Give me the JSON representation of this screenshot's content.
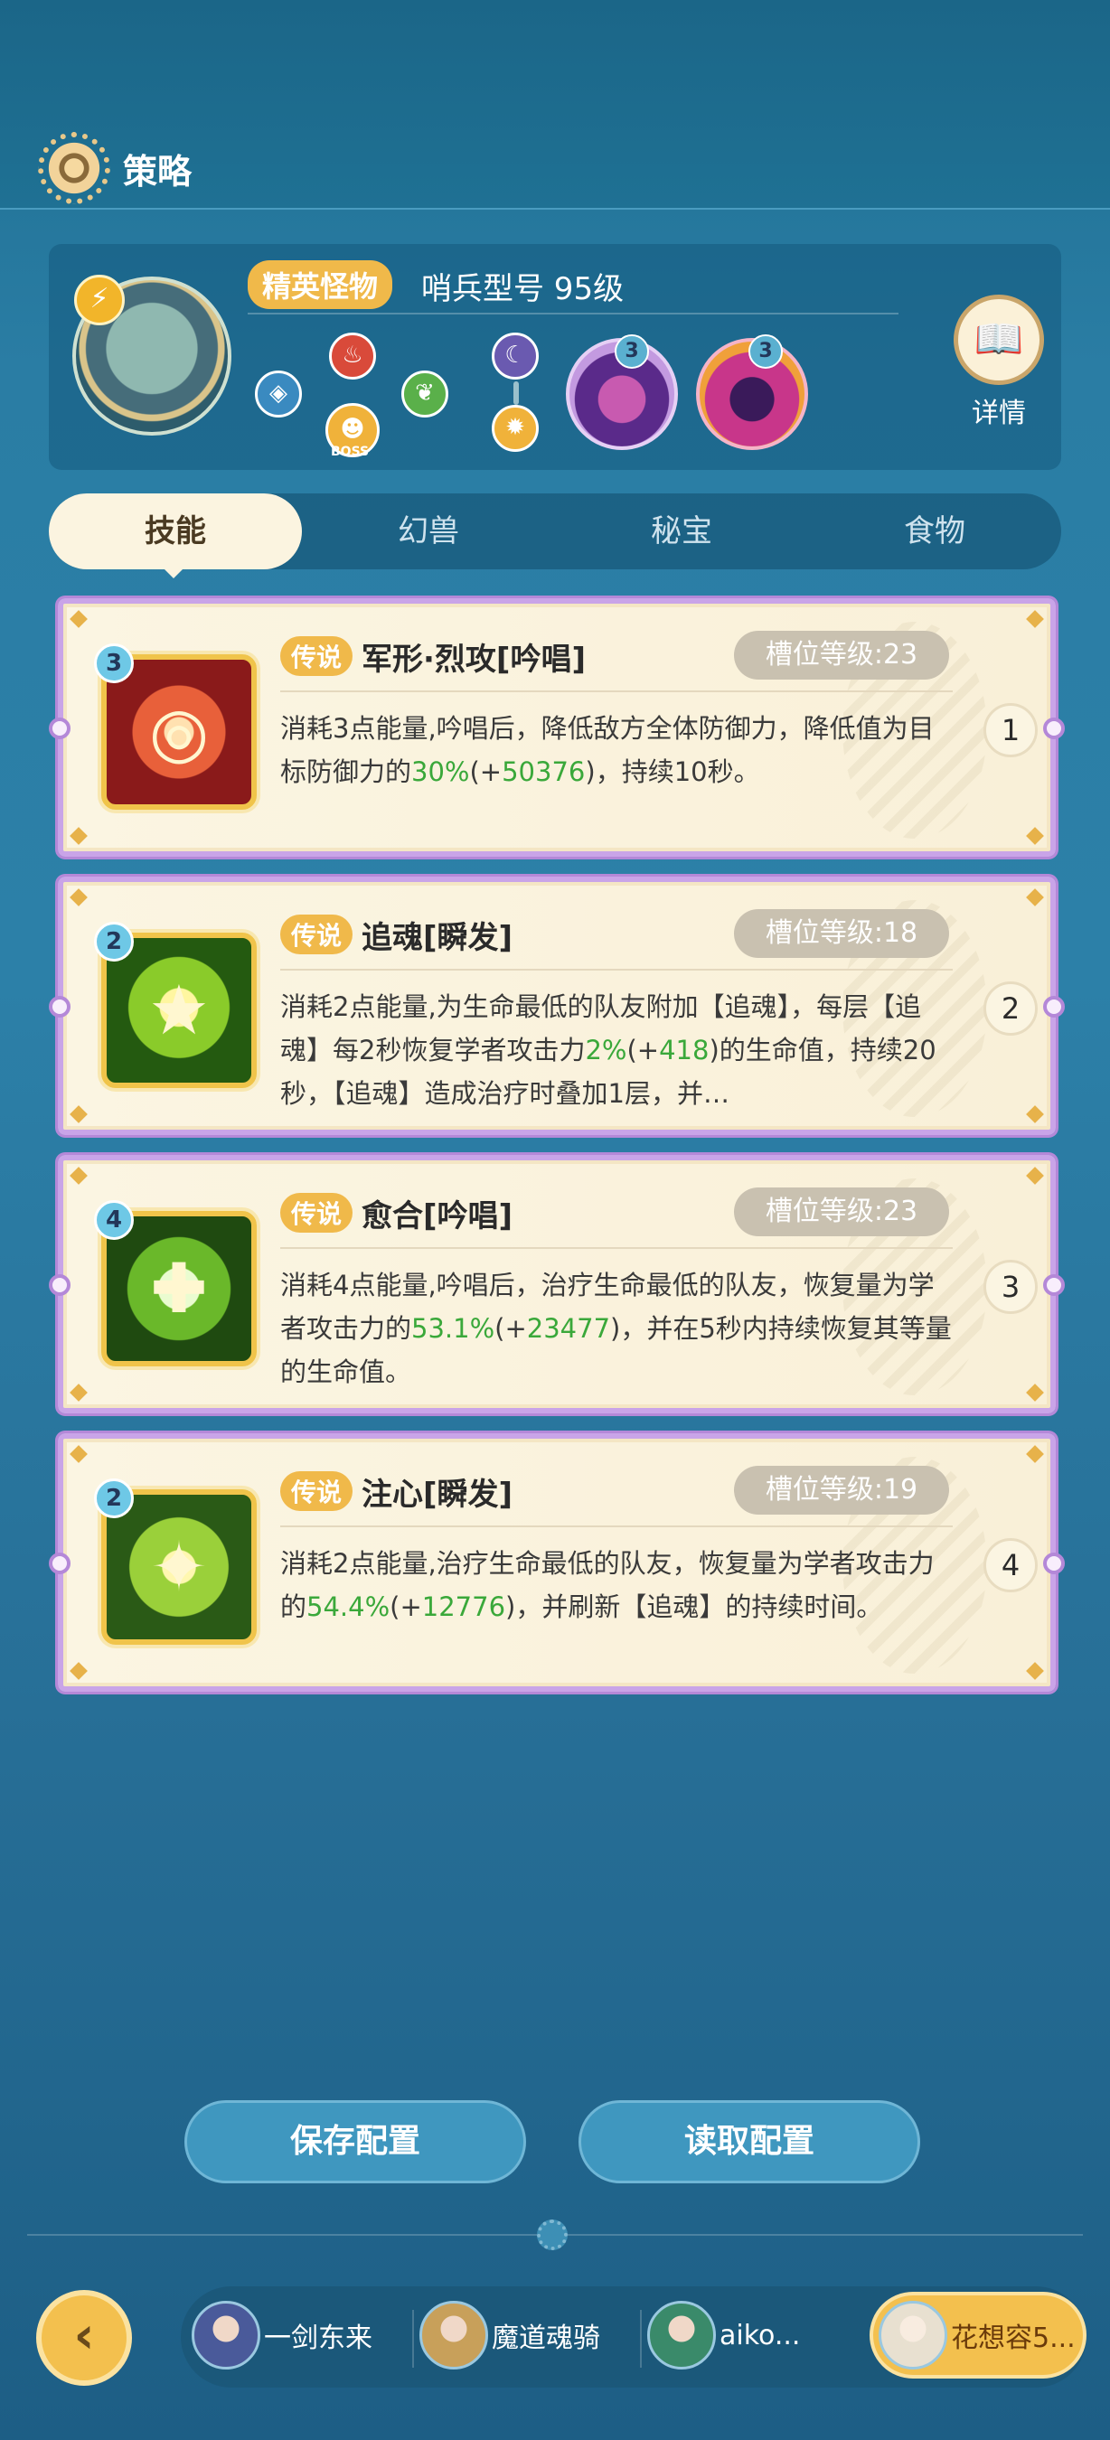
{
  "header": {
    "title": "策略"
  },
  "boss": {
    "tag": "精英怪物",
    "name": "哨兵型号 95级",
    "boss_label": "BOSS",
    "debuffs": [
      {
        "stacks": "3"
      },
      {
        "stacks": "3"
      }
    ],
    "details_label": "详情"
  },
  "tabs": [
    {
      "label": "技能",
      "active": true
    },
    {
      "label": "幻兽",
      "active": false
    },
    {
      "label": "秘宝",
      "active": false
    },
    {
      "label": "食物",
      "active": false
    }
  ],
  "skills": [
    {
      "stars": "3",
      "rarity": "传说",
      "name": "军形·烈攻[吟唱]",
      "slot_level": "槽位等级:23",
      "order": "1",
      "desc_parts": [
        "消耗3点能量,吟唱后，降低敌方全体防御力，降低值为目标防御力的",
        "30%",
        "(+",
        "50376",
        ")，持续10秒。"
      ]
    },
    {
      "stars": "2",
      "rarity": "传说",
      "name": "追魂[瞬发]",
      "slot_level": "槽位等级:18",
      "order": "2",
      "desc_parts": [
        "消耗2点能量,为生命最低的队友附加【追魂】，每层【追魂】每2秒恢复学者攻击力",
        "2%",
        "(+",
        "418",
        ")的生命值，持续20秒，【追魂】造成治疗时叠加1层，并…"
      ]
    },
    {
      "stars": "4",
      "rarity": "传说",
      "name": "愈合[吟唱]",
      "slot_level": "槽位等级:23",
      "order": "3",
      "desc_parts": [
        "消耗4点能量,吟唱后，治疗生命最低的队友，恢复量为学者攻击力的",
        "53.1%",
        "(+",
        "23477",
        ")，并在5秒内持续恢复其等量的生命值。"
      ]
    },
    {
      "stars": "2",
      "rarity": "传说",
      "name": "注心[瞬发]",
      "slot_level": "槽位等级:19",
      "order": "4",
      "desc_parts": [
        "消耗2点能量,治疗生命最低的队友，恢复量为学者攻击力的",
        "54.4%",
        "(+",
        "12776",
        ")，并刷新【追魂】的持续时间。"
      ]
    }
  ],
  "buttons": {
    "save": "保存配置",
    "load": "读取配置"
  },
  "team": {
    "back_icon": "back-arrow-icon",
    "members": [
      {
        "name": "一剑东来"
      },
      {
        "name": "魔道魂骑"
      },
      {
        "name": "aiko..."
      },
      {
        "name": "花想容5..."
      }
    ]
  },
  "colors": {
    "accent": "#f0b94a",
    "highlight_green": "#3aa83a",
    "card_border": "#c9a4e8"
  }
}
